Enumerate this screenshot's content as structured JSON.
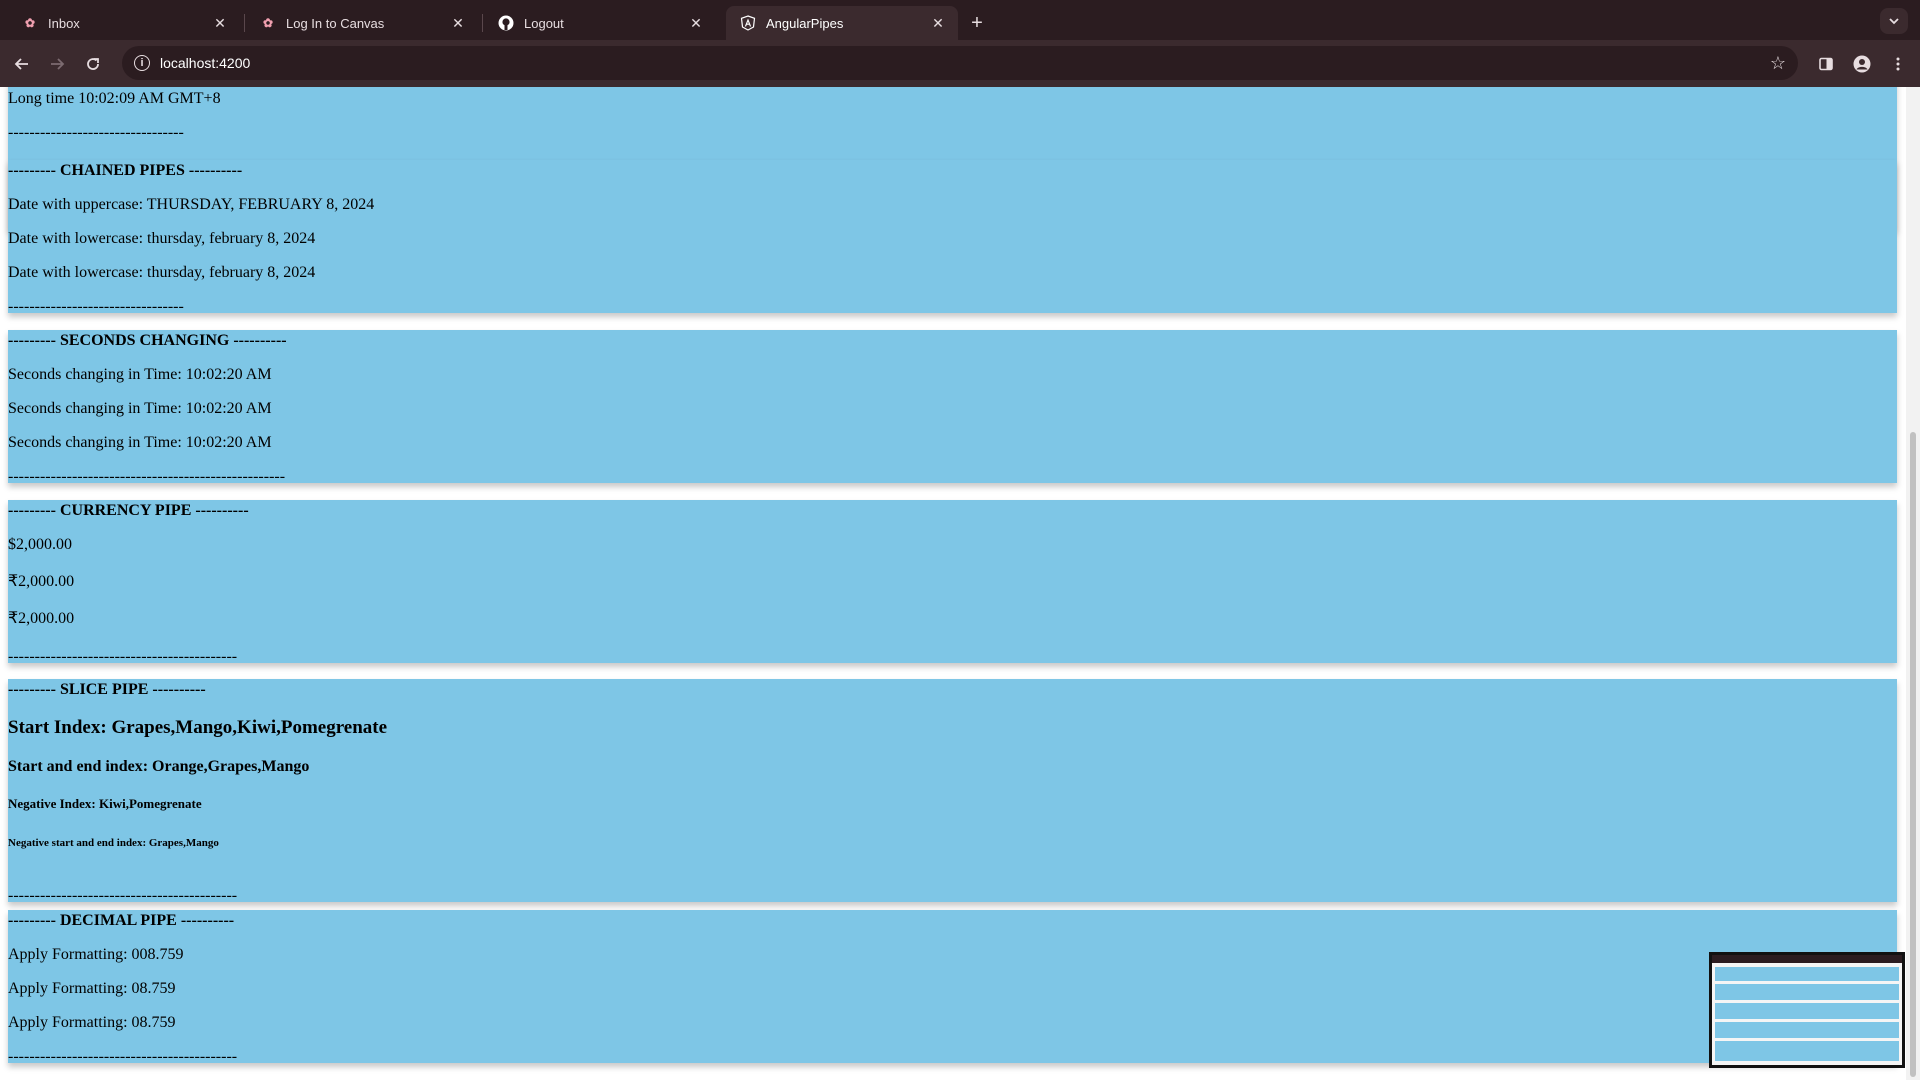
{
  "browser": {
    "tabs": [
      {
        "title": "Inbox",
        "icon": "canvas-icon",
        "active": false
      },
      {
        "title": "Log In to Canvas",
        "icon": "canvas-icon",
        "active": false
      },
      {
        "title": "Logout",
        "icon": "github-icon",
        "active": false
      },
      {
        "title": "AngularPipes",
        "icon": "angular-icon",
        "active": true
      }
    ],
    "url": "localhost:4200"
  },
  "page": {
    "time_section": {
      "long_time": "Long time 10:02:09 AM GMT+8",
      "divider": "---------------------------------"
    },
    "chained_pipes": {
      "heading": "--------- CHAINED PIPES ----------",
      "lines": [
        "Date with uppercase: THURSDAY, FEBRUARY 8, 2024",
        "Date with lowercase: thursday, february 8, 2024",
        "Date with lowercase: thursday, february 8, 2024"
      ],
      "divider": "---------------------------------"
    },
    "seconds_changing": {
      "heading": "--------- SECONDS CHANGING ----------",
      "lines": [
        "Seconds changing in Time: 10:02:20 AM",
        "Seconds changing in Time: 10:02:20 AM",
        "Seconds changing in Time: 10:02:20 AM"
      ],
      "divider": "----------------------------------------------------"
    },
    "currency_pipe": {
      "heading": "--------- CURRENCY PIPE ----------",
      "lines": [
        "$2,000.00",
        "₹2,000.00",
        "₹2,000.00"
      ],
      "divider": "-------------------------------------------"
    },
    "slice_pipe": {
      "heading": "--------- SLICE PIPE ----------",
      "start_index": "Start Index: Grapes,Mango,Kiwi,Pomegrenate",
      "start_end_index": "Start and end index: Orange,Grapes,Mango",
      "negative_index": "Negative Index: Kiwi,Pomegrenate",
      "negative_start_end": "Negative start and end index: Grapes,Mango",
      "divider": "-------------------------------------------"
    },
    "decimal_pipe": {
      "heading": "--------- DECIMAL PIPE ----------",
      "lines": [
        "Apply Formatting: 008.759",
        "Apply Formatting: 08.759",
        "Apply Formatting: 08.759"
      ],
      "divider": "-------------------------------------------"
    }
  },
  "colors": {
    "section_bg": "#7ec6e6",
    "chrome_bg": "#2b1c20",
    "toolbar_bg": "#3b2a2e"
  }
}
